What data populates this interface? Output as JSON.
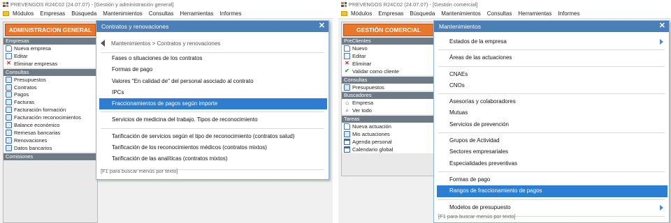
{
  "left_window": {
    "title": "PREVENGOS R24C02 (24.07.07) - [Gestión y administración general]",
    "menu": [
      "Módulos",
      "Empresas",
      "Búsqueda",
      "Mantenimientos",
      "Consultas",
      "Herramientas",
      "Informes"
    ],
    "panel_header": "ADMINISTRACION GENERAL",
    "sections": [
      {
        "title": "Empresas",
        "items": [
          {
            "label": "Nueva empresa",
            "icon": "new-document-icon"
          },
          {
            "label": "Editar",
            "icon": "edit-document-icon"
          },
          {
            "label": "Eliminar empresas",
            "icon": "delete-icon"
          }
        ]
      },
      {
        "title": "Consultas",
        "items": [
          {
            "label": "Presupuestos",
            "icon": "query-icon"
          },
          {
            "label": "Contratos",
            "icon": "query-icon"
          },
          {
            "label": "Pagos",
            "icon": "query-icon"
          },
          {
            "label": "Facturas",
            "icon": "query-icon"
          },
          {
            "label": "Facturación formación",
            "icon": "query-icon"
          },
          {
            "label": "Facturación reconocimientos",
            "icon": "query-icon"
          },
          {
            "label": "Balance económico",
            "icon": "query-icon"
          },
          {
            "label": "Remesas bancarias",
            "icon": "query-icon"
          },
          {
            "label": "Renovaciones",
            "icon": "query-icon"
          },
          {
            "label": "Datos bancarios",
            "icon": "query-icon"
          }
        ]
      },
      {
        "title": "Comisiones",
        "items": []
      }
    ],
    "popup": {
      "title": "Contratos y renovaciones",
      "breadcrumb": "Mantenimientos > Contratos y renovaciones",
      "groups": [
        [
          "Fases o situaciones de los contratos",
          "Formas de pago",
          "Valores \"En calidad de\" del personal asociado al contrato",
          "IPCs",
          "Fraccionamientos de pagos según importe"
        ],
        [
          "Servicios de medicina del trabajo. Tipos de reconocimiento"
        ],
        [
          "Tarificación de servicios según el tipo de reconocimiento (contratos salud)",
          "Tarificación de los reconocimientos médicos (contratos mixtos)",
          "Tarificación de las analíticas (contratos mixtos)"
        ]
      ],
      "selected": "Fraccionamientos de pagos según importe",
      "footer": "[F1 para buscar menús por texto]"
    }
  },
  "right_window": {
    "title": "PREVENGOS R24C02 (24.07.07) - [Gestión comercial]",
    "menu": [
      "Módulos",
      "Empresas",
      "Búsqueda",
      "Mantenimientos",
      "Consultas",
      "Herramientas",
      "Informes"
    ],
    "panel_header": "GESTIÓN COMERCIAL",
    "sections": [
      {
        "title": "PreClientes",
        "items": [
          {
            "label": "Nuevo",
            "icon": "new-document-icon"
          },
          {
            "label": "Editar",
            "icon": "edit-document-icon"
          },
          {
            "label": "Eliminar",
            "icon": "delete-icon"
          },
          {
            "label": "Validar como cliente",
            "icon": "checkmark-icon"
          }
        ]
      },
      {
        "title": "Consultas",
        "items": [
          {
            "label": "Presupuestos",
            "icon": "query-icon"
          }
        ]
      },
      {
        "title": "Buscadores",
        "items": [
          {
            "label": "Empresa",
            "icon": "building-icon"
          },
          {
            "label": "Ver todo",
            "icon": "search-icon"
          }
        ]
      },
      {
        "title": "Tareas",
        "items": [
          {
            "label": "Nueva actuación",
            "icon": "new-document-icon"
          },
          {
            "label": "Mis actuaciones",
            "icon": "list-icon"
          },
          {
            "label": "Agenda personal",
            "icon": "agenda-icon"
          },
          {
            "label": "Calendario global",
            "icon": "calendar-icon"
          }
        ]
      }
    ],
    "popup": {
      "title": "Mantenimientos",
      "groups": [
        [
          "Estados de la empresa"
        ],
        [
          "Áreas de las actuaciones"
        ],
        [
          "CNAEs",
          "CNOs"
        ],
        [
          "Asesorías y colaboradores",
          "Mutuas",
          "Servicios de prevención"
        ],
        [
          "Grupos de Actividad",
          "Sectores empresariales",
          "Especialidades preventivas"
        ],
        [
          "Formas de pago",
          "Rangos de fraccionamiento de pagos"
        ],
        [
          "Modelos de presupuesto"
        ]
      ],
      "has_submenu": [
        "Estados de la empresa",
        "Modelos de presupuesto"
      ],
      "selected": "Rangos de fraccionamiento de pagos",
      "footer": "[F1 para buscar menús por texto]"
    }
  },
  "colors": {
    "accent_orange": "#e8772e",
    "popup_header": "#4a7fb8",
    "selection": "#2d7dd2",
    "section_header": "#6d7b87"
  }
}
